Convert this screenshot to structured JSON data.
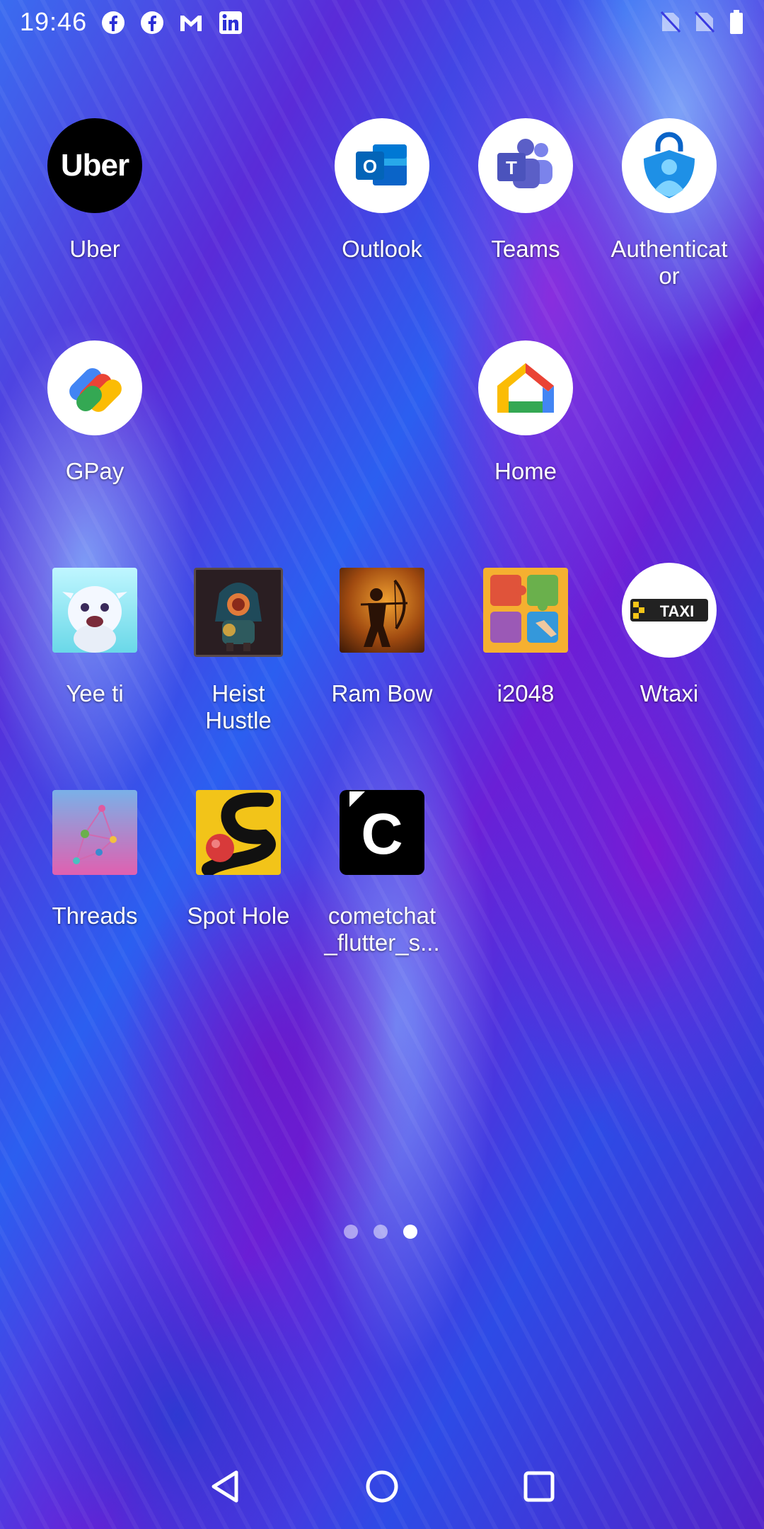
{
  "status_bar": {
    "time": "19:46",
    "notification_icons": [
      "facebook-icon",
      "facebook-icon",
      "gmail-icon",
      "linkedin-icon"
    ],
    "status_icons": [
      "no-sim-icon",
      "no-sim-icon",
      "battery-icon"
    ]
  },
  "apps": [
    {
      "label": "Uber",
      "icon": "uber-icon"
    },
    {
      "label": "Outlook",
      "icon": "outlook-icon"
    },
    {
      "label": "Teams",
      "icon": "teams-icon"
    },
    {
      "label": "Authenticat\nor",
      "icon": "authenticator-icon"
    },
    {
      "label": "GPay",
      "icon": "gpay-icon"
    },
    {
      "label": "Home",
      "icon": "google-home-icon"
    },
    {
      "label": "Yee ti",
      "icon": "yeeti-icon"
    },
    {
      "label": "Heist\nHustle",
      "icon": "heist-hustle-icon"
    },
    {
      "label": "Ram Bow",
      "icon": "ram-bow-icon"
    },
    {
      "label": "i2048",
      "icon": "i2048-icon"
    },
    {
      "label": "Wtaxi",
      "icon": "wtaxi-icon"
    },
    {
      "label": "Threads",
      "icon": "threads-icon"
    },
    {
      "label": "Spot Hole",
      "icon": "spot-hole-icon"
    },
    {
      "label": "cometchat\n_flutter_s...",
      "icon": "cometchat-icon"
    }
  ],
  "icon_text": {
    "uber": "Uber",
    "outlook": "O",
    "teams": "T",
    "taxi": "TAXI",
    "cometchat": "C"
  },
  "page_indicator": {
    "pages": 3,
    "current": 3
  },
  "nav_bar": [
    "back-icon",
    "home-icon",
    "recents-icon"
  ],
  "colors": {
    "uber_bg": "#000000",
    "outlook_blue": "#0a64c8",
    "teams_purple": "#5b5fc7",
    "authenticator_blue": "#1e90e6",
    "taxi_yellow": "#f5c518"
  }
}
